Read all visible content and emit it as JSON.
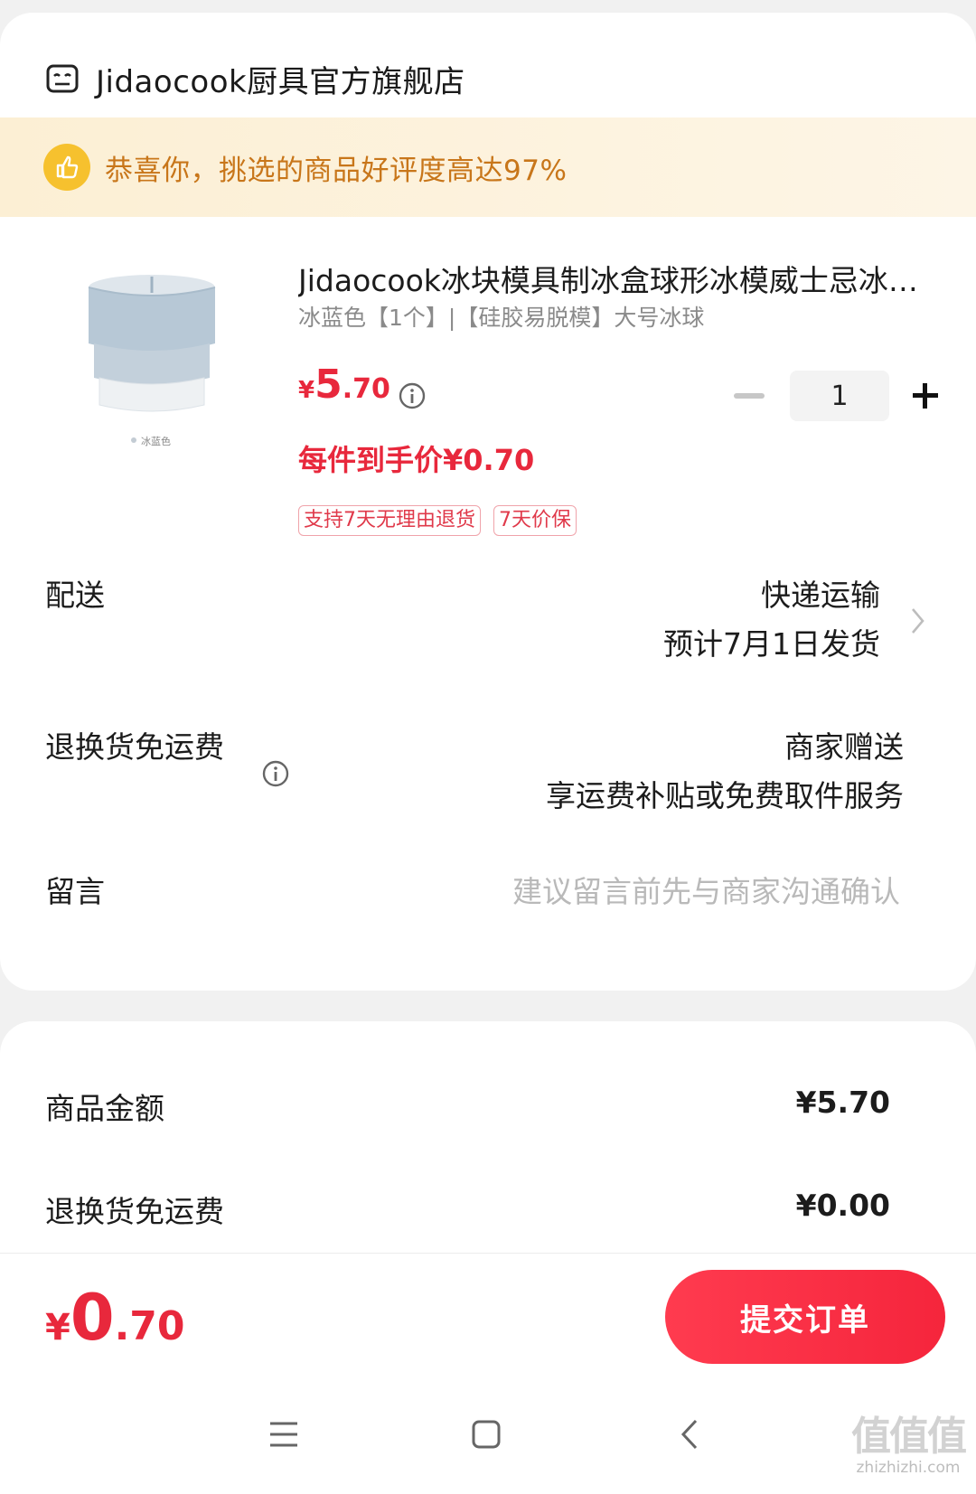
{
  "store": {
    "name": "Jidaocook厨具官方旗舰店",
    "icon": "store-icon"
  },
  "banner": {
    "text": "恭喜你，挑选的商品好评度高达97%",
    "icon": "thumbs-up-icon",
    "accent": "#c8761a"
  },
  "product": {
    "image_label": "冰蓝色",
    "title": "Jidaocook冰块模具制冰盒球形冰模威士忌冰球模具",
    "spec": "冰蓝色【1个】|【硅胶易脱模】大号冰球",
    "price": {
      "currency": "¥",
      "integer": "5",
      "decimal": ".70"
    },
    "quantity": "1",
    "net_price": "每件到手价¥0.70",
    "tags": [
      "支持7天无理由退货",
      "7天价保"
    ]
  },
  "delivery": {
    "label": "配送",
    "method": "快递运输",
    "estimate": "预计7月1日发货"
  },
  "return_shipping": {
    "label": "退换货免运费",
    "value": "商家赠送",
    "note": "享运费补贴或免费取件服务"
  },
  "message": {
    "label": "留言",
    "placeholder": "建议留言前先与商家沟通确认"
  },
  "summary": [
    {
      "label": "商品金额",
      "value": "¥5.70"
    },
    {
      "label": "退换货免运费",
      "value": "¥0.00"
    }
  ],
  "total": {
    "currency": "¥",
    "integer": "0",
    "decimal": ".70"
  },
  "submit_label": "提交订单",
  "watermark": {
    "main": "值值值",
    "sub": "zhizhizhi.com"
  },
  "colors": {
    "price_red": "#e8283c",
    "button_red": "#f5253c",
    "banner_bg": "#fcefd4"
  }
}
